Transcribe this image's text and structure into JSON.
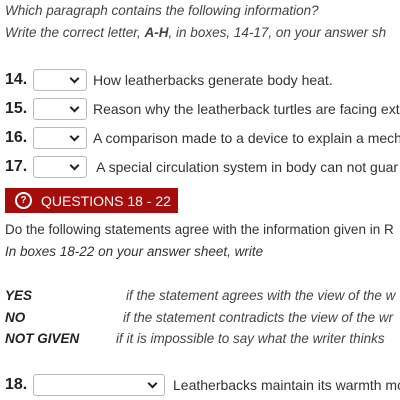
{
  "instructions": {
    "line1": "Which paragraph contains the following information?",
    "line2_prefix": "Write the correct letter, ",
    "line2_bold": "A-H",
    "line2_suffix": ", in boxes, 14-17, on your answer sh"
  },
  "questions_14_17": [
    {
      "number": "14.",
      "text": "How leatherbacks generate body heat."
    },
    {
      "number": "15.",
      "text": "Reason why the leatherback turtles are facing ext"
    },
    {
      "number": "16.",
      "text": "A comparison made to a device to explain a mech"
    },
    {
      "number": "17.",
      "text": " A special circulation system in body can not guar"
    }
  ],
  "section_banner": {
    "icon": "?",
    "label": "QUESTIONS 18 - 22",
    "color": "#a50d0d"
  },
  "section_intro": {
    "line1": "Do the following statements agree with the information given in R",
    "line2": "In boxes 18-22 on your answer sheet, write"
  },
  "answer_key": [
    {
      "key": "YES",
      "desc": "if the statement agrees with the view of the w"
    },
    {
      "key": "NO",
      "desc": "if the statement contradicts the view of the wr"
    },
    {
      "key": "NOT GIVEN",
      "desc": "if it is impossible to say what the writer thinks"
    }
  ],
  "question_18": {
    "number": "18.",
    "text": "Leatherbacks maintain its warmth mo"
  }
}
